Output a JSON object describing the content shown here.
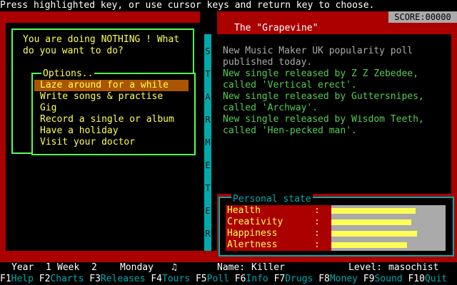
{
  "top_instruction": "Press highlighted key, or use cursor keys and return key to choose.",
  "score": "SCORE:00000",
  "starmeter_letters": [
    "S",
    "T",
    "A",
    "R",
    "M",
    "E",
    "T",
    "E",
    "R"
  ],
  "dialog": {
    "prompt": "You are doing NOTHING ! What\ndo you want to do?",
    "options_title": "Options..",
    "options": [
      {
        "label": "Laze around for a while",
        "selected": true
      },
      {
        "label": "Write songs & practise",
        "selected": false
      },
      {
        "label": "Gig",
        "selected": false
      },
      {
        "label": "Record a single or album",
        "selected": false
      },
      {
        "label": "Have a holiday",
        "selected": false
      },
      {
        "label": "Visit your doctor",
        "selected": false
      }
    ]
  },
  "grapevine": {
    "title": "The \"Grapevine\"",
    "lines": [
      {
        "text": "New Music Maker UK popularity poll",
        "color": "#aaaaaa"
      },
      {
        "text": "published today.",
        "color": "#aaaaaa"
      },
      {
        "text": "New single released by Z Z Zebedee,",
        "color": "#55cc55"
      },
      {
        "text": "called 'Vertical erect'.",
        "color": "#55cc55"
      },
      {
        "text": "New single released by Guttersnipes,",
        "color": "#55cc55"
      },
      {
        "text": "called 'Archway'.",
        "color": "#55cc55"
      },
      {
        "text": "New single released by Wisdom Teeth,",
        "color": "#55cc55"
      },
      {
        "text": "called 'Hen-pecked man'.",
        "color": "#55cc55"
      }
    ]
  },
  "personal_state": {
    "title": "Personal state",
    "stats": [
      {
        "label": "Health",
        "sep": ":",
        "level": 0.74
      },
      {
        "label": "Creativity",
        "sep": ":",
        "level": 0.7
      },
      {
        "label": "Happiness",
        "sep": ":",
        "level": 0.75
      },
      {
        "label": "Alertness",
        "sep": ":",
        "level": 0.66
      }
    ]
  },
  "status": {
    "year_label": "Year",
    "year": "1",
    "week_label": "Week",
    "week": "2",
    "day": "Monday",
    "note_icon": "♫",
    "name_label": "Name:",
    "name": "Killer",
    "level_label": "Level:",
    "level": "masochist"
  },
  "fkeys": [
    {
      "key": "F1",
      "label": "Help"
    },
    {
      "key": "F2",
      "label": "Charts"
    },
    {
      "key": "F3",
      "label": "Releases"
    },
    {
      "key": "F4",
      "label": "Tours"
    },
    {
      "key": "F5",
      "label": "Poll"
    },
    {
      "key": "F6",
      "label": "Info"
    },
    {
      "key": "F7",
      "label": "Drugs"
    },
    {
      "key": "F8",
      "label": "Money"
    },
    {
      "key": "F9",
      "label": "Sound"
    },
    {
      "key": "F10",
      "label": "Quit"
    }
  ],
  "colors": {
    "frame": "#aa0000",
    "highlight": "#aa5500",
    "accent_text": "#ffff55",
    "cyan": "#00aaaa"
  }
}
